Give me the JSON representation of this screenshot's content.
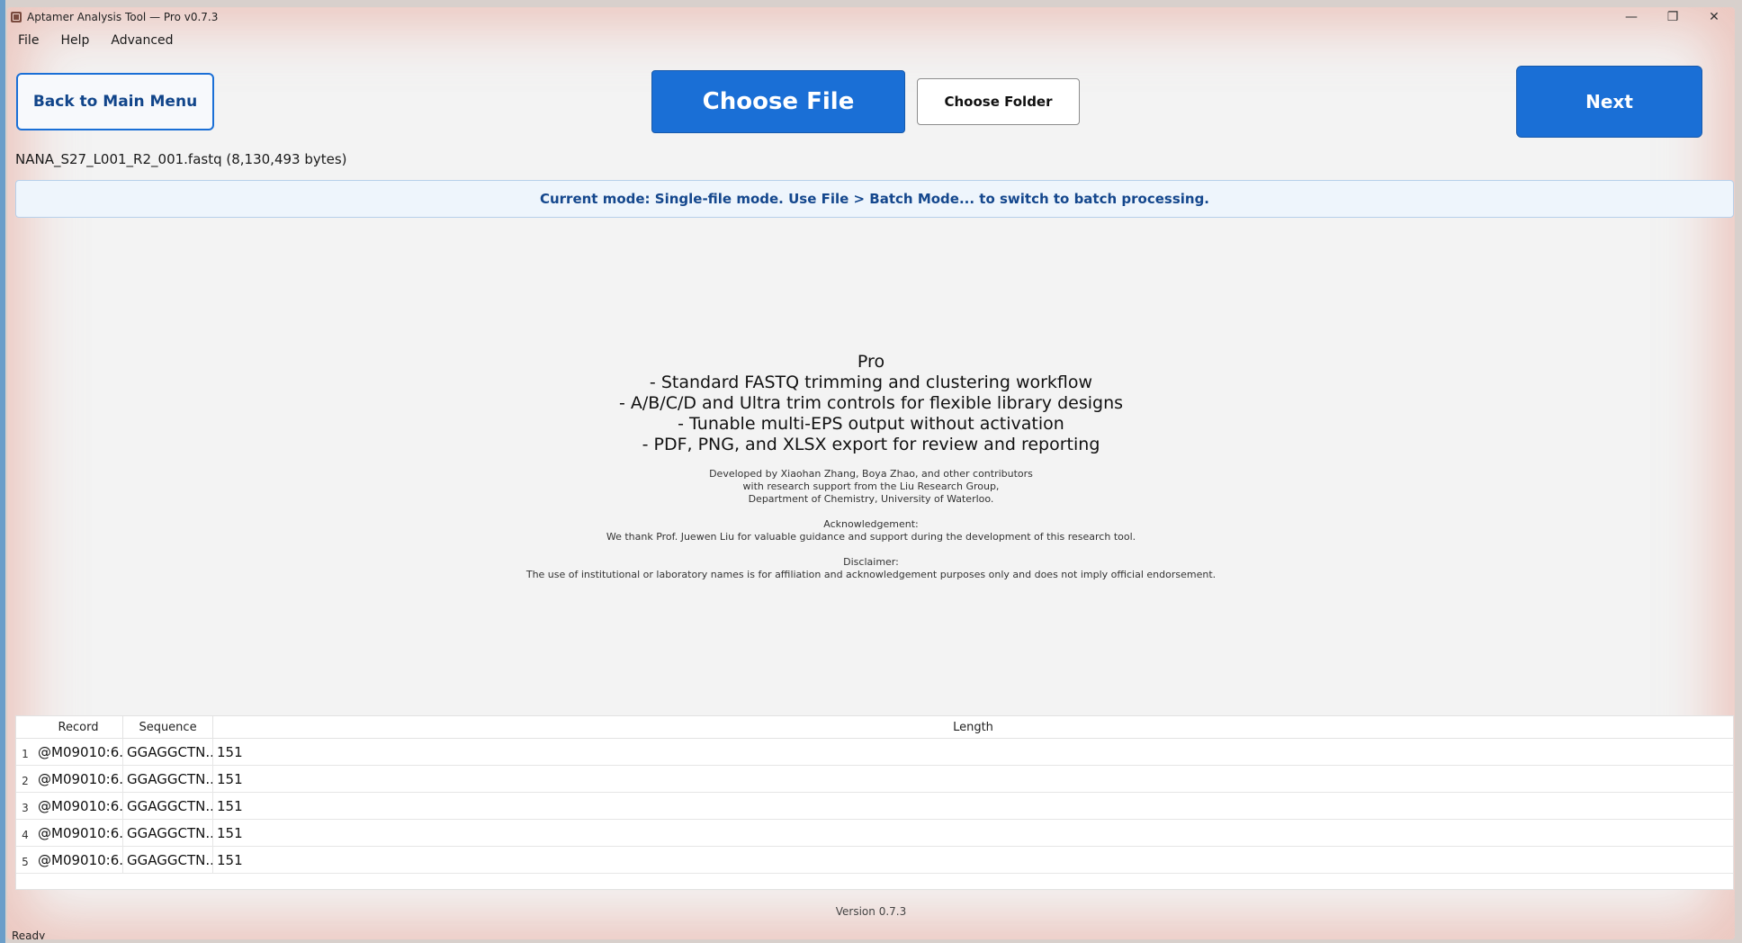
{
  "window": {
    "title": "Aptamer Analysis Tool — Pro v0.7.3",
    "controls": {
      "minimize": "—",
      "maximize": "❐",
      "close": "✕"
    }
  },
  "menu": [
    "File",
    "Help",
    "Advanced"
  ],
  "toolbar": {
    "back_label": "Back to Main Menu",
    "choose_file_label": "Choose File",
    "choose_folder_label": "Choose Folder",
    "next_label": "Next"
  },
  "file_info": "NANA_S27_L001_R2_001.fastq (8,130,493 bytes)",
  "mode_banner": "Current mode: Single-file mode. Use File > Batch Mode... to switch to batch processing.",
  "info": {
    "heading": "Pro",
    "features": [
      "- Standard FASTQ trimming and clustering workflow",
      "- A/B/C/D and Ultra trim controls for flexible library designs",
      "- Tunable multi-EPS output without activation",
      "- PDF, PNG, and XLSX export for review and reporting"
    ],
    "credits": [
      "Developed by Xiaohan Zhang, Boya Zhao, and other contributors",
      "with research support from the Liu Research Group,",
      "Department of Chemistry, University of Waterloo."
    ],
    "acknowledgement_title": "Acknowledgement:",
    "acknowledgement": "We thank Prof. Juewen Liu for valuable guidance and support during the development of this research tool.",
    "disclaimer_title": "Disclaimer:",
    "disclaimer": "The use of institutional or laboratory names is for affiliation and acknowledgement purposes only and does not imply official endorsement."
  },
  "table": {
    "columns": [
      "Record",
      "Sequence",
      "Length"
    ],
    "rows": [
      {
        "index": "1",
        "record": "@M09010:6...",
        "sequence": "GGAGGCTN...",
        "length": "151"
      },
      {
        "index": "2",
        "record": "@M09010:6...",
        "sequence": "GGAGGCTN...",
        "length": "151"
      },
      {
        "index": "3",
        "record": "@M09010:6...",
        "sequence": "GGAGGCTN...",
        "length": "151"
      },
      {
        "index": "4",
        "record": "@M09010:6...",
        "sequence": "GGAGGCTN...",
        "length": "151"
      },
      {
        "index": "5",
        "record": "@M09010:6...",
        "sequence": "GGAGGCTN...",
        "length": "151"
      }
    ]
  },
  "version": "Version 0.7.3",
  "status": "Ready"
}
